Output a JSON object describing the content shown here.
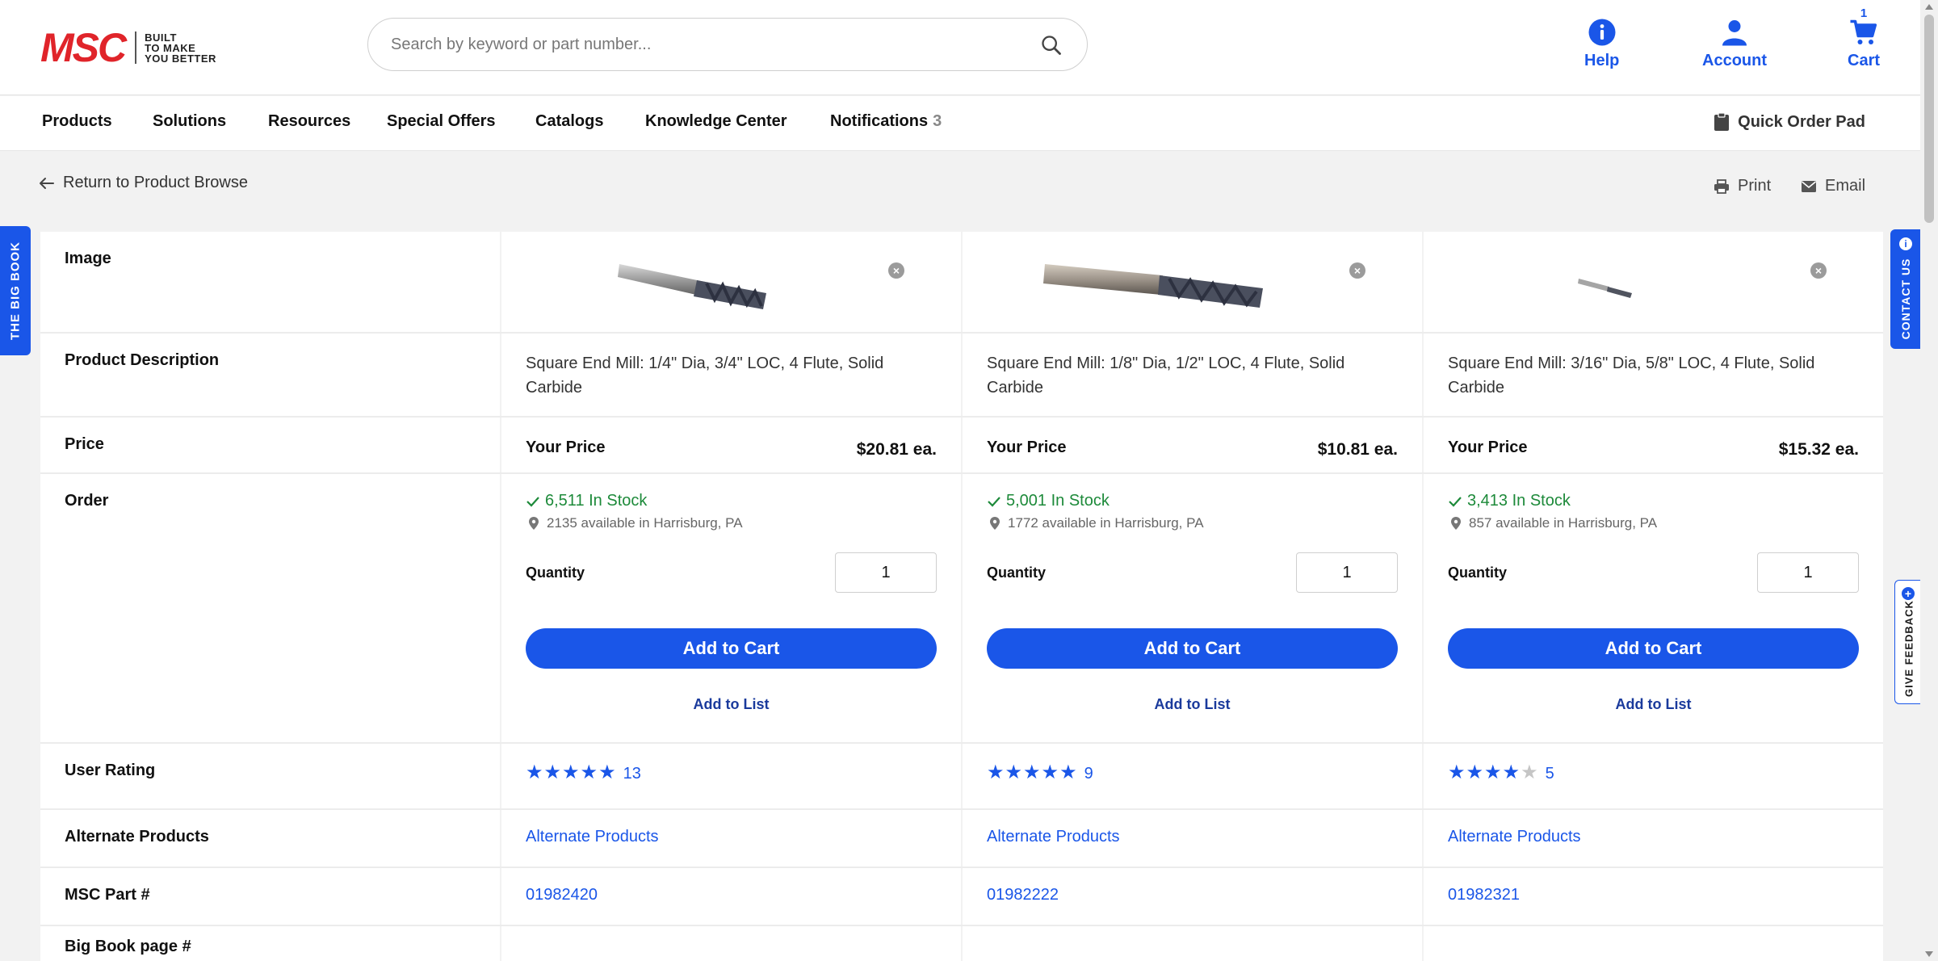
{
  "header": {
    "logo": "MSC",
    "tagline": [
      "BUILT",
      "TO MAKE",
      "YOU BETTER"
    ],
    "search_placeholder": "Search by keyword or part number...",
    "help_label": "Help",
    "account_label": "Account",
    "cart_label": "Cart",
    "cart_count": "1"
  },
  "nav": {
    "items": [
      "Products",
      "Solutions",
      "Resources",
      "Special Offers",
      "Catalogs",
      "Knowledge Center",
      "Notifications"
    ],
    "notifications_count": "3",
    "quick_order": "Quick Order Pad"
  },
  "subbar": {
    "return": "Return to Product Browse",
    "print": "Print",
    "email": "Email"
  },
  "side_tabs": {
    "big_book": "THE BIG BOOK",
    "contact": "CONTACT US",
    "feedback": "GIVE FEEDBACK"
  },
  "row_labels": {
    "image": "Image",
    "description": "Product Description",
    "price": "Price",
    "order": "Order",
    "rating": "User Rating",
    "alternates": "Alternate Products",
    "part": "MSC Part #",
    "big_book_page": "Big Book page #"
  },
  "common": {
    "your_price": "Your Price",
    "quantity": "Quantity",
    "add_to_cart": "Add to Cart",
    "add_to_list": "Add to List",
    "alternate_products": "Alternate Products"
  },
  "products": [
    {
      "description": "Square End Mill: 1/4\" Dia, 3/4\" LOC, 4 Flute, Solid Carbide",
      "price": "$20.81 ea.",
      "stock": "6,511 In Stock",
      "availability": "2135 available in Harrisburg, PA",
      "quantity": "1",
      "rating": 5,
      "rating_count": "13",
      "part_number": "01982420"
    },
    {
      "description": "Square End Mill: 1/8\" Dia, 1/2\" LOC, 4 Flute, Solid Carbide",
      "price": "$10.81 ea.",
      "stock": "5,001 In Stock",
      "availability": "1772 available in Harrisburg, PA",
      "quantity": "1",
      "rating": 5,
      "rating_count": "9",
      "part_number": "01982222"
    },
    {
      "description": "Square End Mill: 3/16\" Dia, 5/8\" LOC, 4 Flute, Solid Carbide",
      "price": "$15.32 ea.",
      "stock": "3,413 In Stock",
      "availability": "857 available in Harrisburg, PA",
      "quantity": "1",
      "rating": 4,
      "rating_count": "5",
      "part_number": "01982321"
    }
  ],
  "colors": {
    "brand_red": "#e0242a",
    "accent_blue": "#1a56e8",
    "stock_green": "#1d8a3a"
  }
}
